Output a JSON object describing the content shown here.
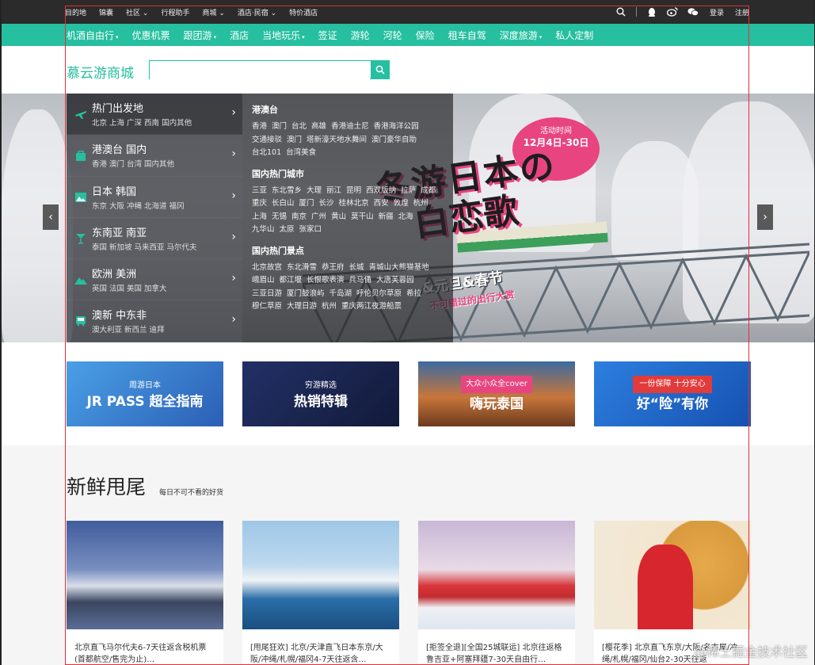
{
  "topbar": {
    "links": [
      "目的地",
      "锦囊",
      "社区 ⌄",
      "行程助手",
      "商城 ⌄",
      "酒店·民宿 ⌄",
      "特价酒店"
    ],
    "login": "登录",
    "register": "注册"
  },
  "nav": {
    "items": [
      {
        "label": "机酒自由行",
        "caret": true
      },
      {
        "label": "优惠机票",
        "caret": false
      },
      {
        "label": "跟团游",
        "caret": true
      },
      {
        "label": "酒店",
        "caret": false
      },
      {
        "label": "当地玩乐",
        "caret": true
      },
      {
        "label": "签证",
        "caret": false
      },
      {
        "label": "游轮",
        "caret": false
      },
      {
        "label": "河轮",
        "caret": false
      },
      {
        "label": "保险",
        "caret": false
      },
      {
        "label": "租车自驾",
        "caret": false
      },
      {
        "label": "深度旅游",
        "caret": true
      },
      {
        "label": "私人定制",
        "caret": false
      }
    ],
    "caret_glyph": "▾"
  },
  "header": {
    "logo": "慕云游商城",
    "search_placeholder": ""
  },
  "categories": [
    {
      "title": "热门出发地",
      "sub": "北京  上海  广深  西南  国内其他",
      "icon": "plane-icon"
    },
    {
      "title": "港澳台 国内",
      "sub": "香港  澳门  台湾  国内其他",
      "icon": "bag-icon"
    },
    {
      "title": "日本 韩国",
      "sub": "东京  大阪  冲绳  北海道  福冈",
      "icon": "picture-icon"
    },
    {
      "title": "东南亚 南亚",
      "sub": "泰国  新加坡  马来西亚  马尔代夫",
      "icon": "cocktail-icon"
    },
    {
      "title": "欧洲 美洲",
      "sub": "英国  法国  美国  加拿大",
      "icon": "mountain-icon"
    },
    {
      "title": "澳新 中东非",
      "sub": "澳大利亚  新西兰  迪拜",
      "icon": "bus-icon"
    }
  ],
  "subpanel": [
    {
      "heading": "港澳台",
      "links": [
        "香港",
        "澳门",
        "台北",
        "高雄",
        "香港迪士尼",
        "香港海洋公园",
        "交通接驳",
        "澳门",
        "塔新濠天地水舞间",
        "澳门豪华自助",
        "台北101",
        "台湾美食"
      ]
    },
    {
      "heading": "国内热门城市",
      "links": [
        "三亚",
        "东北雪乡",
        "大理",
        "丽江",
        "昆明",
        "西双版纳",
        "拉萨",
        "成都",
        "重庆",
        "长白山",
        "厦门",
        "长沙",
        "桂林北京",
        "西安",
        "敦煌",
        "杭州",
        "上海",
        "无锡",
        "南京",
        "广州",
        "黄山",
        "莫干山",
        "新疆",
        "北海",
        "九华山",
        "太原",
        "张家口"
      ]
    },
    {
      "heading": "国内热门景点",
      "links": [
        "北京故宫",
        "东北滑雪",
        "恭王府",
        "长城",
        "青城山大熊猫基地",
        "峨眉山",
        "都江堰",
        "长恨歌表演",
        "兵马俑",
        "大唐芙蓉园",
        "三亚日游",
        "厦门鼓浪屿",
        "千岛湖",
        "呼伦贝尔草原",
        "希拉",
        "穆仁草原",
        "大理日游",
        "杭州",
        "重庆两江夜游船票"
      ]
    }
  ],
  "banner": {
    "badge_line1": "活动时间",
    "badge_line2": "12月4日-30日",
    "title_line1": "冬游日本の",
    "title_line2": "白恋歌",
    "sub_line1": "&元旦&春节",
    "sub_line2": "不可错过的出行大赏",
    "prev": "‹",
    "next": "›"
  },
  "cards": [
    {
      "title": "周游日本",
      "title2": "JR PASS 超全指南",
      "bg": "#3a7ccf"
    },
    {
      "title": "穷游精选",
      "title2": "热销特辑",
      "bg": "#1f2a55"
    },
    {
      "title": "大众小众全cover",
      "title2": "嗨玩泰国",
      "bg": "#b0532c"
    },
    {
      "title": "一份保障 十分安心",
      "title2": "好“险”有你",
      "bg": "#1c63c6"
    }
  ],
  "fresh": {
    "title": "新鲜甩尾",
    "tag": "每日不可不看的好货",
    "items": [
      {
        "caption": "北京直飞马尔代夫6-7天往返含税机票(首都航空/售完为止)…"
      },
      {
        "caption": "[甩尾狂欢] 北京/天津直飞日本东京/大阪/冲绳/札幌/福冈4-7天往返含…"
      },
      {
        "caption": "[拒签全退][全国25城联运] 北京往返格鲁吉亚+阿塞拜疆7-30天自由行…"
      },
      {
        "caption": "[樱花季] 北京直飞东京/大阪/名古屋/冲绳/札幌/福冈/仙台2-30天往返"
      }
    ]
  },
  "watermark": "@稀土掘金技术社区",
  "colors": {
    "brand": "#26bfa0",
    "topbar": "#2b2b2b",
    "promo_pink": "#e8447f"
  }
}
